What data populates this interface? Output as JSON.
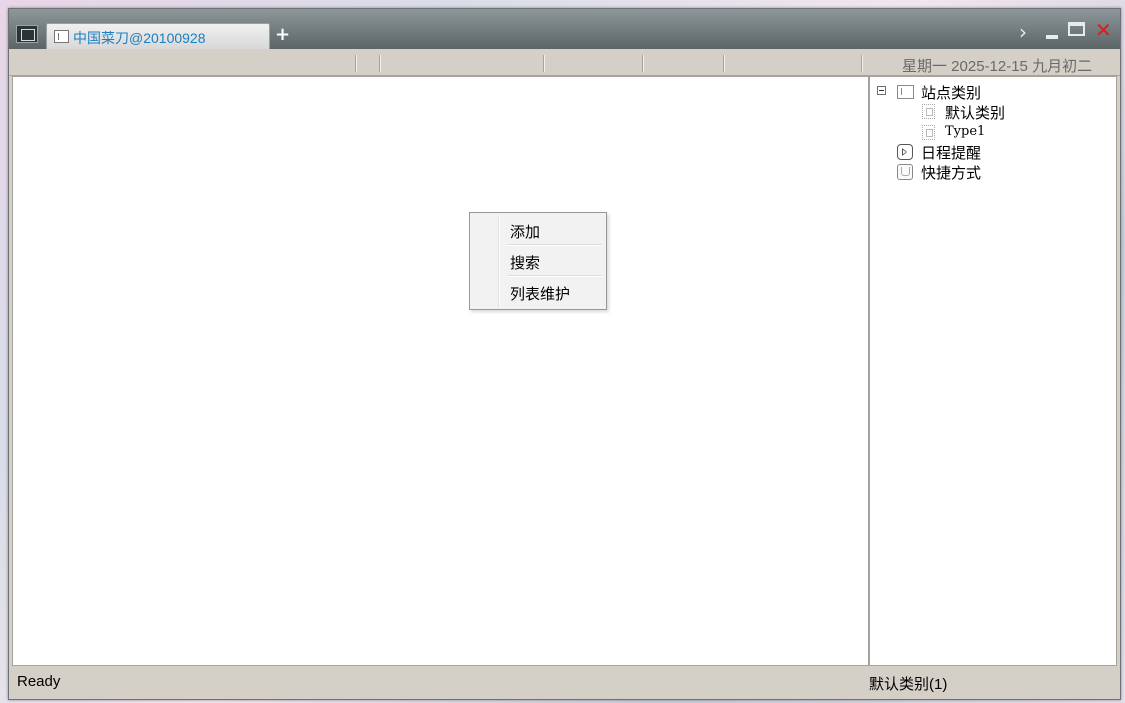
{
  "window": {
    "tab_label": "中国菜刀@20100928",
    "add_tab_label": "+",
    "chevron_label": "›",
    "close_label": "✕"
  },
  "toolbar": {
    "date_text": "星期一 2025-12-15 九月初二"
  },
  "tree": {
    "items": [
      {
        "label": "站点类别",
        "icon": "folder-icon",
        "expanded": true
      },
      {
        "label": "默认类别",
        "icon": "document-icon"
      },
      {
        "label": "Type1",
        "icon": "document-icon"
      },
      {
        "label": "日程提醒",
        "icon": "schedule-icon"
      },
      {
        "label": "快捷方式",
        "icon": "hand-icon"
      }
    ]
  },
  "context_menu": {
    "items": [
      {
        "label": "添加"
      },
      {
        "label": "搜索"
      },
      {
        "label": "列表维护"
      }
    ]
  },
  "status": {
    "left": "Ready",
    "right": "默认类别(1)"
  },
  "colors": {
    "tab_text": "#1b7fc0",
    "close": "#e31b1b",
    "chrome": "#d4d0c8"
  }
}
